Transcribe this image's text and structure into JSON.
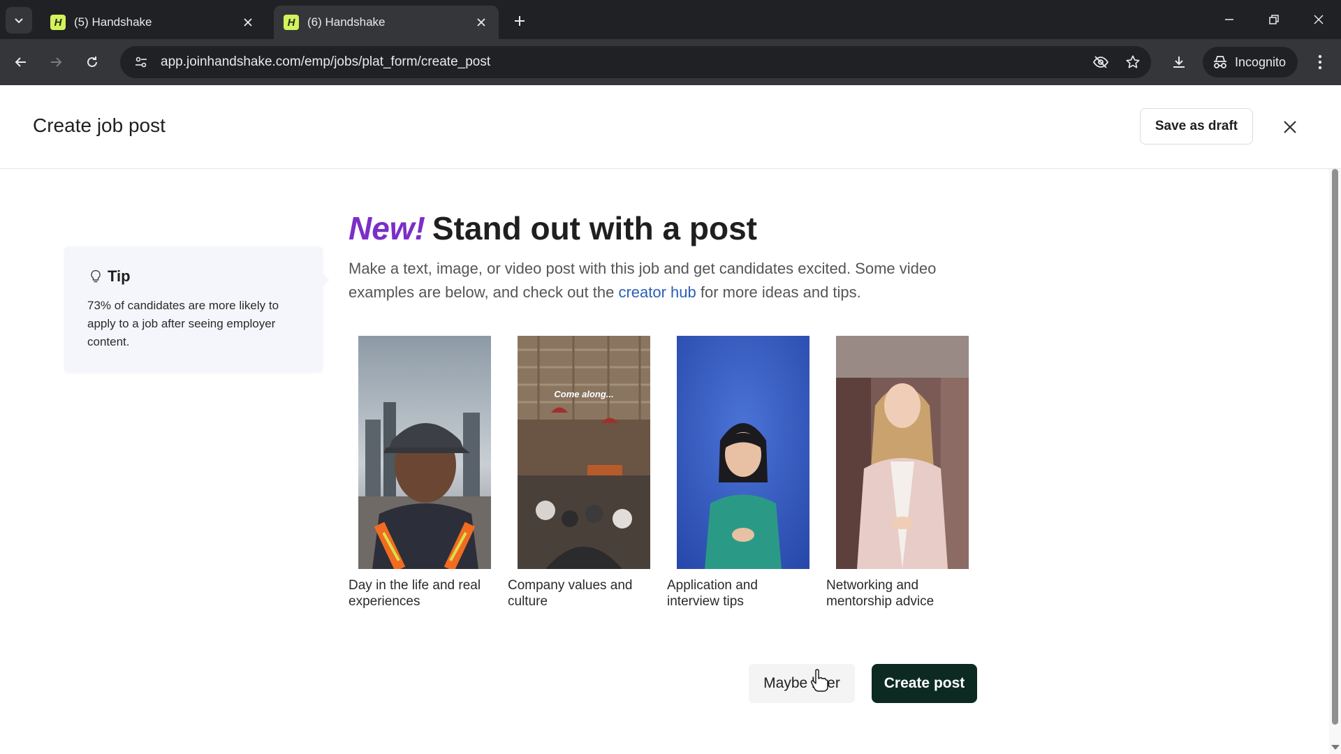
{
  "browser": {
    "tabs": [
      {
        "favicon": "H",
        "title": "(5) Handshake",
        "active": false
      },
      {
        "favicon": "H",
        "title": "(6) Handshake",
        "active": true
      }
    ],
    "url": "app.joinhandshake.com/emp/jobs/plat_form/create_post",
    "profile_label": "Incognito"
  },
  "header": {
    "title": "Create job post",
    "save_draft_label": "Save as draft"
  },
  "tip": {
    "title": "Tip",
    "text": "73% of candidates are more likely to apply to a job after seeing employer content."
  },
  "main": {
    "headline_new": "New!",
    "headline_rest": "Stand out with a post",
    "intro_before": "Make a text, image, or video post with this job and get candidates excited. Some video examples are below, and check out the ",
    "intro_link": "creator hub",
    "intro_after": " for more ideas and tips.",
    "videos": [
      {
        "caption": "Day in the life and real experiences",
        "overlay": ""
      },
      {
        "caption": "Company values and culture",
        "overlay": "Come along..."
      },
      {
        "caption": "Application and interview tips",
        "overlay": ""
      },
      {
        "caption": "Networking and mentorship advice",
        "overlay": ""
      }
    ]
  },
  "actions": {
    "later_label": "Maybe later",
    "create_label": "Create post"
  },
  "colors": {
    "accent_purple": "#7b2fc8",
    "link_blue": "#2b5fb8",
    "primary_button": "#0c2a22",
    "tip_background": "#f5f6fb"
  }
}
